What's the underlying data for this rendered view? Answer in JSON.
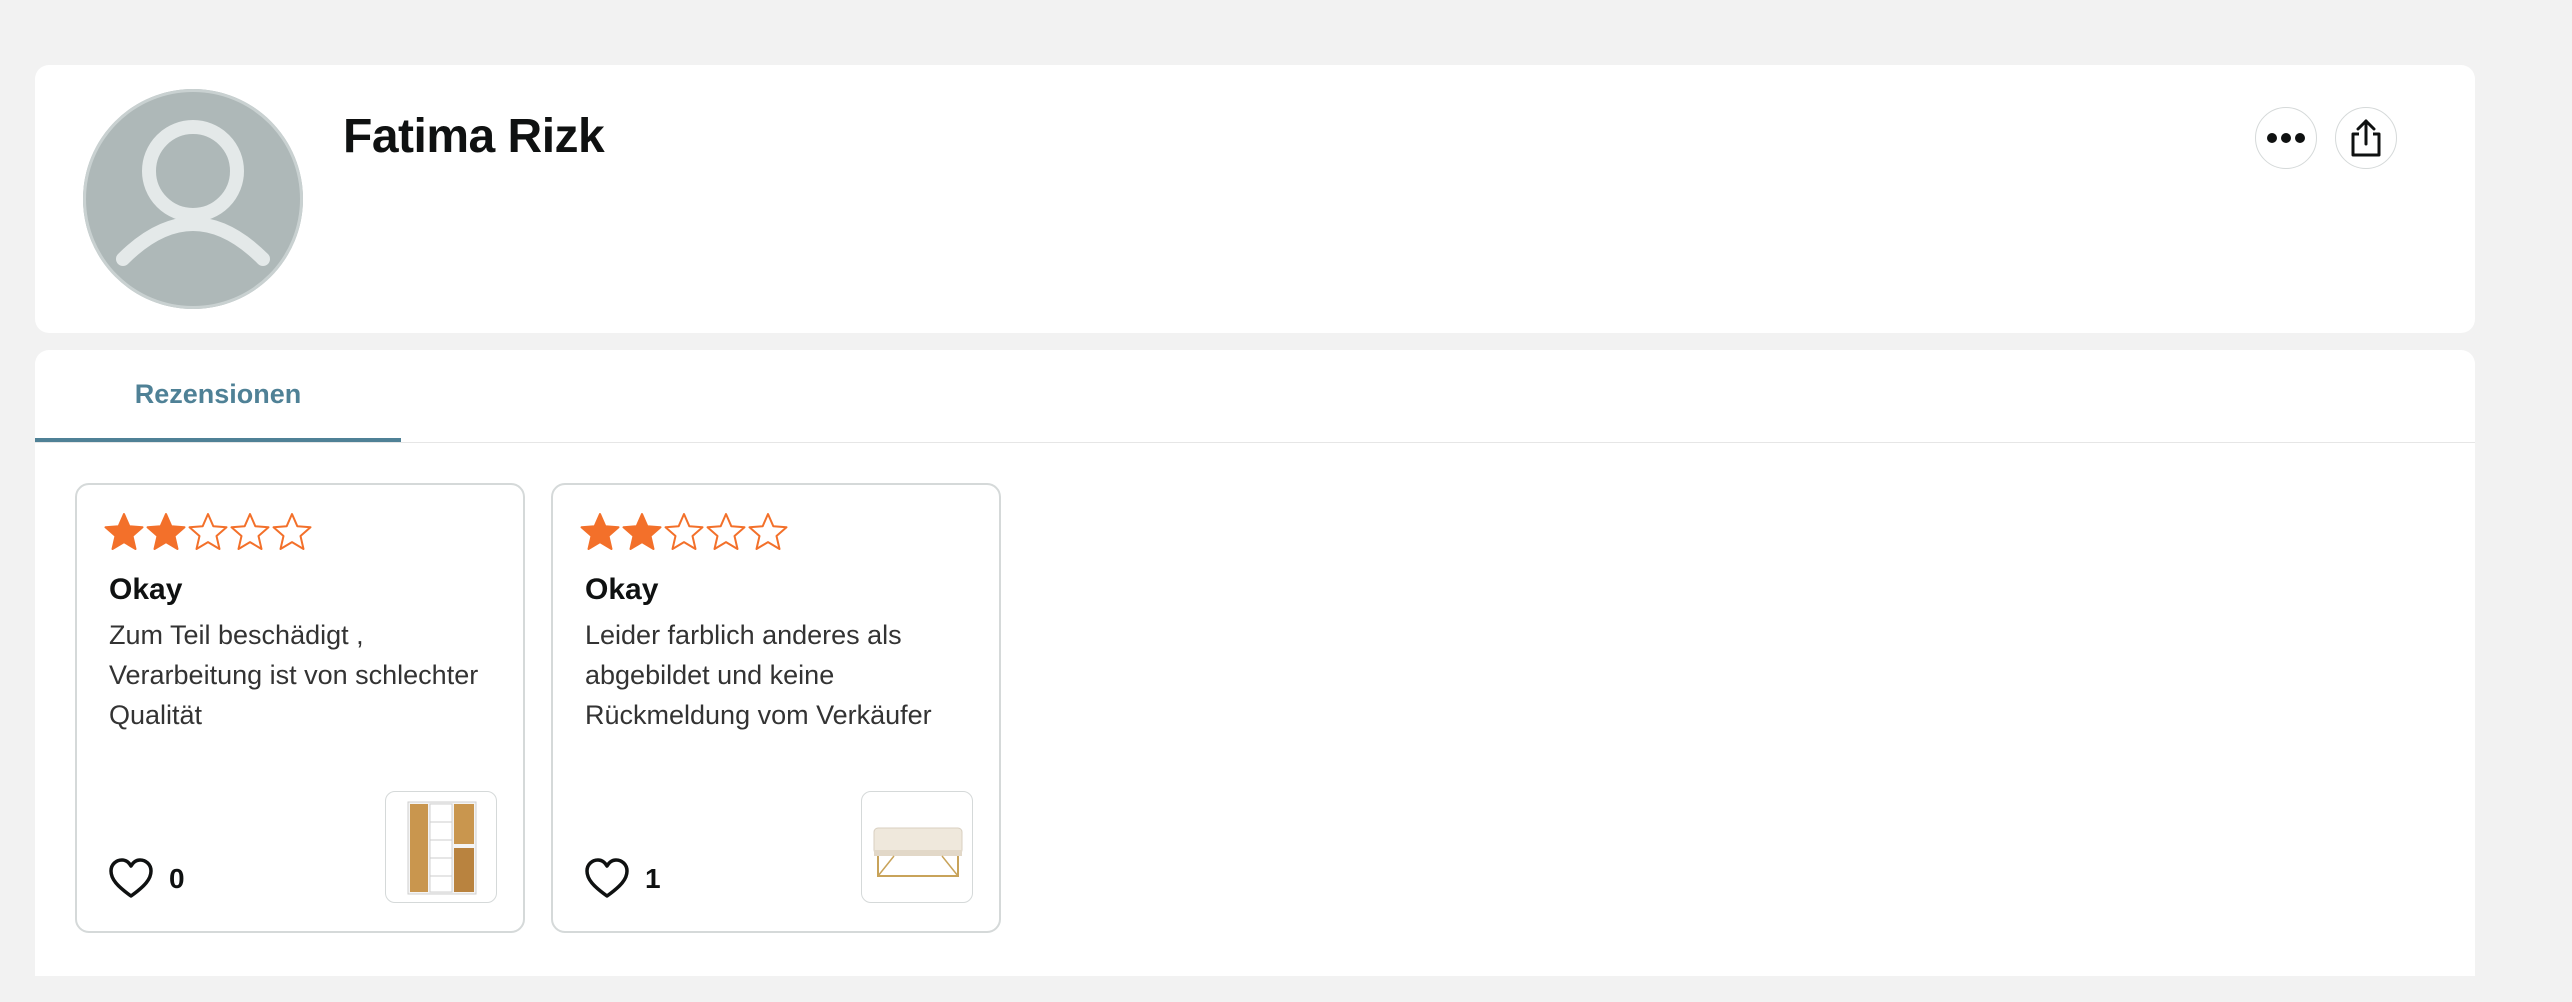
{
  "profile": {
    "name": "Fatima Rizk",
    "avatar_icon": "default-user-avatar-icon",
    "more_icon": "ellipsis-icon",
    "share_icon": "share-icon"
  },
  "tabs": [
    {
      "label": "Rezensionen",
      "active": true
    }
  ],
  "reviews": [
    {
      "rating": 2,
      "max_rating": 5,
      "title": "Okay",
      "text": "Zum Teil beschädigt , Verarbeitung ist von schlechter Qualität",
      "likes": "0",
      "product_icon": "wardrobe-cabinet-thumbnail"
    },
    {
      "rating": 2,
      "max_rating": 5,
      "title": "Okay",
      "text": "Leider farblich anderes als abgebildet und keine Rückmeldung vom Verkäufer",
      "likes": "1",
      "product_icon": "upholstered-bench-thumbnail"
    }
  ],
  "colors": {
    "star": "#f3702a",
    "tab_active": "#4f8196",
    "avatar_bg": "#aeb8b8"
  }
}
